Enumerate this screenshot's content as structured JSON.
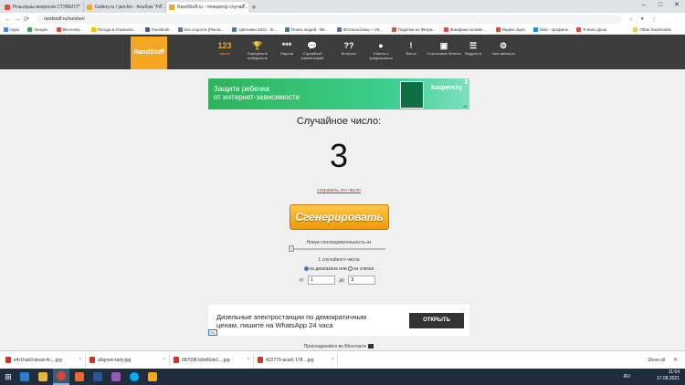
{
  "browser": {
    "tabs": [
      {
        "label": "Розыгрыш вопросов СТУВЬТО",
        "color": "#e84c3d"
      },
      {
        "label": "Gallery.ru / janchis - Альбом \"Ро...",
        "color": "#f5a623"
      },
      {
        "label": "RandStuff.ru - генератор случай...",
        "color": "#f5a623"
      }
    ],
    "active_tab": 2,
    "url": "randstuff.ru/number/",
    "bookmarks": [
      "Apps",
      "Экоцен",
      "Ми-и-игр...",
      "Погода в Ульяновс...",
      "Facebook",
      "все соцсети (Рекла...",
      "Цветники 2021 - В...",
      "Поиск людей - ВК...",
      "Фотоальбомы ~ VK...",
      "Поделки из Фетра...",
      "Фанфики онлайн ...",
      "Яндекс.Букс",
      "Mail - профиль",
      "Я Кино Доха"
    ],
    "other_bookmarks": "Other bookmarks",
    "nav_icons": [
      "back-icon",
      "forward-icon",
      "reload-icon"
    ]
  },
  "site": {
    "logo": "RandStuff",
    "nav": [
      {
        "icon": "123",
        "label": "Число"
      },
      {
        "icon": "🏆",
        "label": "Определить победителя"
      },
      {
        "icon": "***",
        "label": "Пароли"
      },
      {
        "icon": "💬",
        "label": "Случайный комментарий"
      },
      {
        "icon": "??",
        "label": "Вопросы"
      },
      {
        "icon": "●",
        "label": "Ответы и предсказания"
      },
      {
        "icon": "!",
        "label": "Факты"
      },
      {
        "icon": "▣",
        "label": "Счастливые билеты"
      },
      {
        "icon": "☰",
        "label": "Мудрости"
      },
      {
        "icon": "⚙",
        "label": "Чем заняться"
      }
    ]
  },
  "ad_top": {
    "text_line1": "Защити ребенка",
    "text_line2": "от интернет-зависимости",
    "brand": "kaspersky",
    "mini": "0+"
  },
  "main": {
    "title": "Случайное число:",
    "number": "3",
    "save_link": "сохранить это число",
    "generate_label": "Сгенерировать",
    "sequence_label": "Новую последовательность из",
    "count_label": "1 случайного числа",
    "radio_range": "из диапазона",
    "radio_or": "или",
    "radio_list": "из списка",
    "from_label": "от",
    "to_label": "до",
    "from_value": "1",
    "to_value": "3"
  },
  "ad_bottom": {
    "text_line1": "Дизельные электростанции по демократичным",
    "text_line2": "ценам, пишите на WhatsApp 24 часа",
    "button": "ОТКРЫТЬ",
    "tag": "ЯД"
  },
  "vk_label": "Присоединяйся во ВКонтакте",
  "downloads": {
    "items": [
      "e4r1hak9-dead-4c....jpg",
      "a6qnwn-tariy.jpg",
      "687098 b9e86de1....jpg",
      "422779-acai9-178....jpg"
    ],
    "show_all": "Show all"
  },
  "taskbar": {
    "apps": [
      {
        "name": "ie-icon",
        "color": "#2b7cd3"
      },
      {
        "name": "explorer-icon",
        "color": "#e8b53d"
      },
      {
        "name": "chrome-icon",
        "color": "#db4437"
      },
      {
        "name": "media-icon",
        "color": "#e86a2c"
      },
      {
        "name": "word-icon",
        "color": "#2b579a"
      },
      {
        "name": "paint-icon",
        "color": "#9b59b6"
      },
      {
        "name": "skype-icon",
        "color": "#00aff0"
      },
      {
        "name": "app-icon",
        "color": "#f5a623"
      }
    ],
    "lang": "RU",
    "time": "11:54",
    "date": "17.08.2021"
  }
}
